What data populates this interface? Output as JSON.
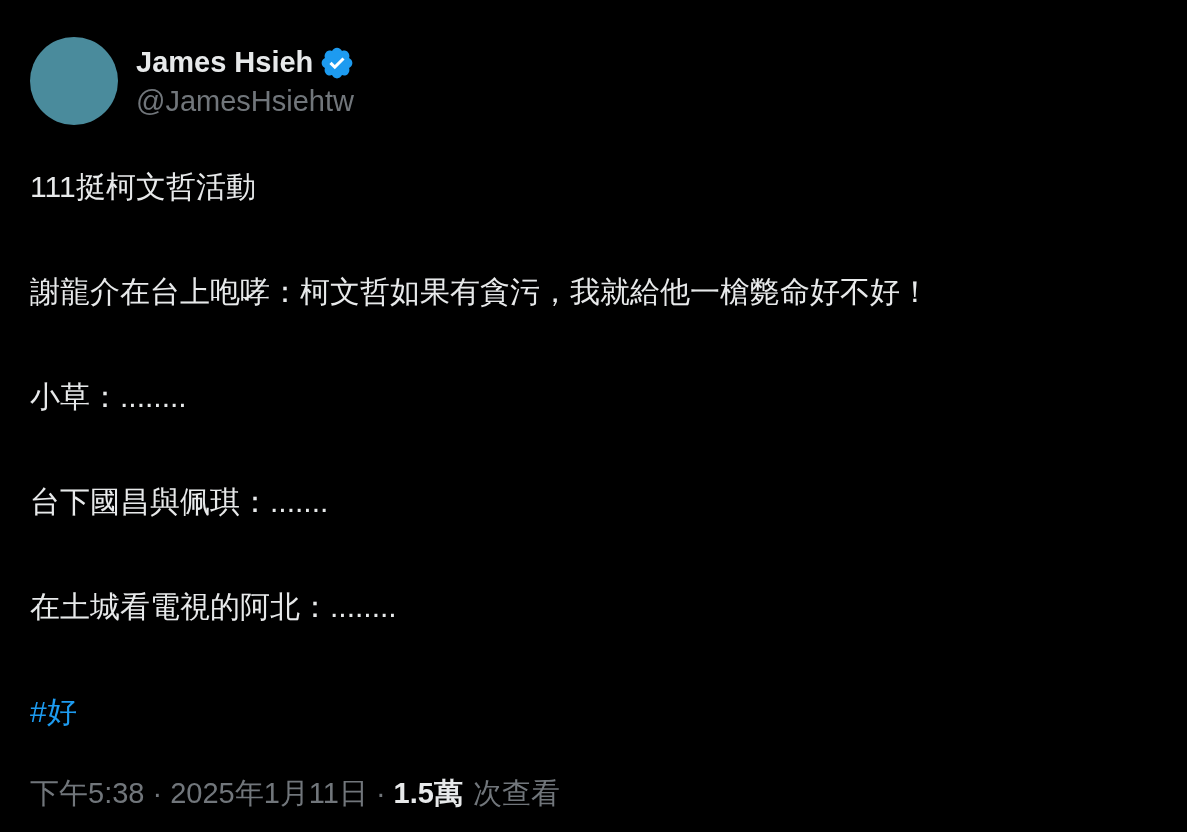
{
  "author": {
    "name": "James Hsieh",
    "verified": true,
    "handle": "@JamesHsiehtw"
  },
  "body": [
    {
      "kind": "text",
      "text": "111挺柯文哲活動"
    },
    {
      "kind": "text",
      "text": "謝龍介在台上咆哮：柯文哲如果有貪污，我就給他一槍斃命好不好！"
    },
    {
      "kind": "text",
      "text": "小草：........"
    },
    {
      "kind": "text",
      "text": "台下國昌與佩琪：......."
    },
    {
      "kind": "text",
      "text": "在土城看電視的阿北：........"
    },
    {
      "kind": "hashtag",
      "text": "#好"
    }
  ],
  "meta": {
    "time": "下午5:38",
    "separator_1": "·",
    "date": "2025年1月11日",
    "separator_2": "·",
    "views_count": "1.5萬",
    "views_label": "次查看"
  }
}
